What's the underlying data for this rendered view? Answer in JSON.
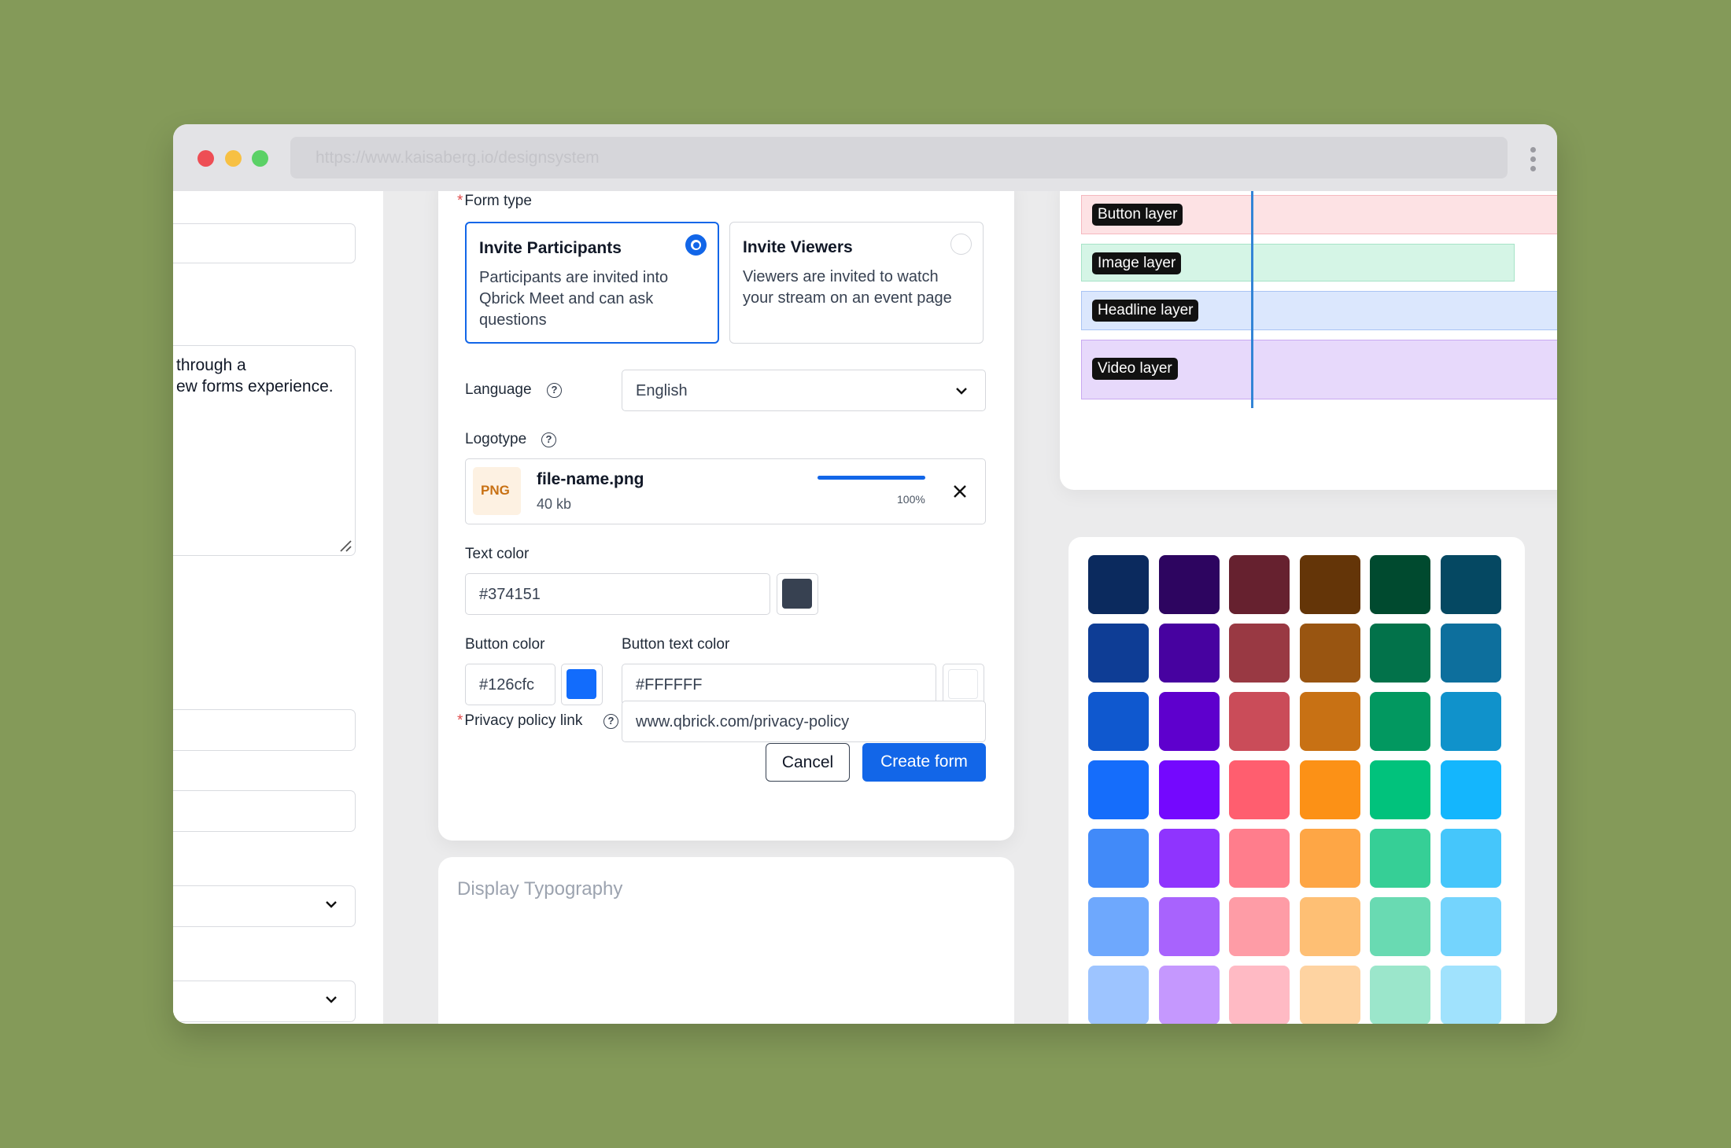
{
  "browser": {
    "url": "https://www.kaisaberg.io/designsystem"
  },
  "left_panel": {
    "textarea_line1": "through a",
    "textarea_line2": "ew forms experience."
  },
  "form": {
    "form_type_label": "Form type",
    "options": [
      {
        "title": "Invite Participants",
        "desc": "Participants are invited into Qbrick Meet and can ask questions",
        "selected": true
      },
      {
        "title": "Invite Viewers",
        "desc": "Viewers are invited to watch your stream on an event page",
        "selected": false
      }
    ],
    "language_label": "Language",
    "language_value": "English",
    "logotype_label": "Logotype",
    "file": {
      "badge": "PNG",
      "name": "file-name.png",
      "size": "40 kb",
      "progress_label": "100%",
      "progress": 1.0
    },
    "text_color_label": "Text color",
    "text_color_value": "#374151",
    "button_color_label": "Button color",
    "button_color_value": "#126cfc",
    "button_text_color_label": "Button text color",
    "button_text_color_value": "#FFFFFF",
    "privacy_label": "Privacy policy link",
    "privacy_value": "www.qbrick.com/privacy-policy",
    "cancel_label": "Cancel",
    "create_label": "Create form",
    "colors": {
      "accent": "#1266e8",
      "text_swatch": "#374151",
      "button_swatch": "#126cfc",
      "button_text_swatch": "#FFFFFF"
    }
  },
  "typography": {
    "title": "Display Typography"
  },
  "layers": [
    {
      "label": "Button layer",
      "bg": "#fde2e4",
      "border": "#f5b8bf"
    },
    {
      "label": "Image layer",
      "bg": "#d5f5e6",
      "border": "#a6e3c7"
    },
    {
      "label": "Headline layer",
      "bg": "#dbe7fd",
      "border": "#a9c4f4"
    },
    {
      "label": "Video layer",
      "bg": "#e7d9fb",
      "border": "#c8a9f1"
    }
  ],
  "palette": [
    [
      "#0b2a5e",
      "#2d0560",
      "#66212f",
      "#643508",
      "#004a2f",
      "#054862"
    ],
    [
      "#0e3d95",
      "#4702a0",
      "#993943",
      "#995511",
      "#02724a",
      "#0d6f9d"
    ],
    [
      "#0f58cf",
      "#5e00cd",
      "#ca4c59",
      "#c87114",
      "#029860",
      "#1092cb"
    ],
    [
      "#156dfb",
      "#7408fe",
      "#ff5e6f",
      "#fc9116",
      "#01c27c",
      "#14b6fd"
    ],
    [
      "#418af9",
      "#8f34fe",
      "#ff7d8c",
      "#fea645",
      "#36cf96",
      "#45c6fb"
    ],
    [
      "#6ea8fd",
      "#a863fd",
      "#fe9ca6",
      "#febf74",
      "#69dab2",
      "#74d4fd"
    ],
    [
      "#9dc4ff",
      "#c598fe",
      "#ffbac4",
      "#fed3a1",
      "#9be6cb",
      "#a0e2fd"
    ],
    [
      "#cfe0fd",
      "#e1cafd",
      "#fddce1",
      "#fde7cf",
      "#cdf1e4",
      "#d0f0fd"
    ]
  ]
}
